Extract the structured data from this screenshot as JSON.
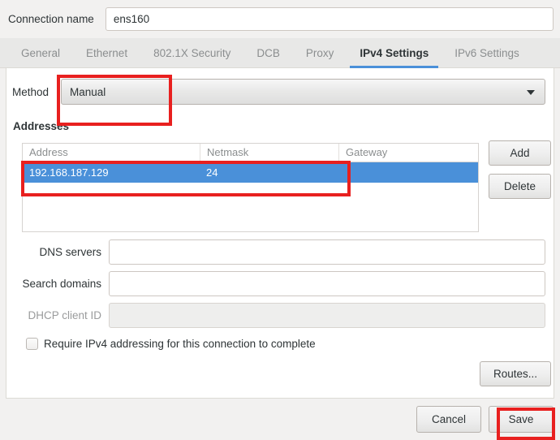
{
  "header": {
    "connection_name_label": "Connection name",
    "connection_name_value": "ens160"
  },
  "tabs": [
    {
      "label": "General",
      "active": false
    },
    {
      "label": "Ethernet",
      "active": false
    },
    {
      "label": "802.1X Security",
      "active": false
    },
    {
      "label": "DCB",
      "active": false
    },
    {
      "label": "Proxy",
      "active": false
    },
    {
      "label": "IPv4 Settings",
      "active": true
    },
    {
      "label": "IPv6 Settings",
      "active": false
    }
  ],
  "method": {
    "label": "Method",
    "selected": "Manual",
    "arrow_icon": "chevron-down-icon"
  },
  "addresses": {
    "section_title": "Addresses",
    "columns": [
      "Address",
      "Netmask",
      "Gateway"
    ],
    "rows": [
      {
        "address": "192.168.187.129",
        "netmask": "24",
        "gateway": "",
        "selected": true
      }
    ],
    "add_label": "Add",
    "delete_label": "Delete"
  },
  "fields": {
    "dns_label": "DNS servers",
    "dns_value": "",
    "search_label": "Search domains",
    "search_value": "",
    "dhcp_label": "DHCP client ID",
    "dhcp_value": "",
    "dhcp_disabled": true
  },
  "require_ipv4": {
    "label": "Require IPv4 addressing for this connection to complete",
    "checked": false
  },
  "routes": {
    "label": "Routes..."
  },
  "footer": {
    "cancel_label": "Cancel",
    "save_label": "Save"
  },
  "colors": {
    "accent": "#4a90d9",
    "selection": "#4a90d9",
    "annotation": "#e8201f",
    "window_bg": "#f2f1f0",
    "panel_bg": "#ffffff"
  }
}
